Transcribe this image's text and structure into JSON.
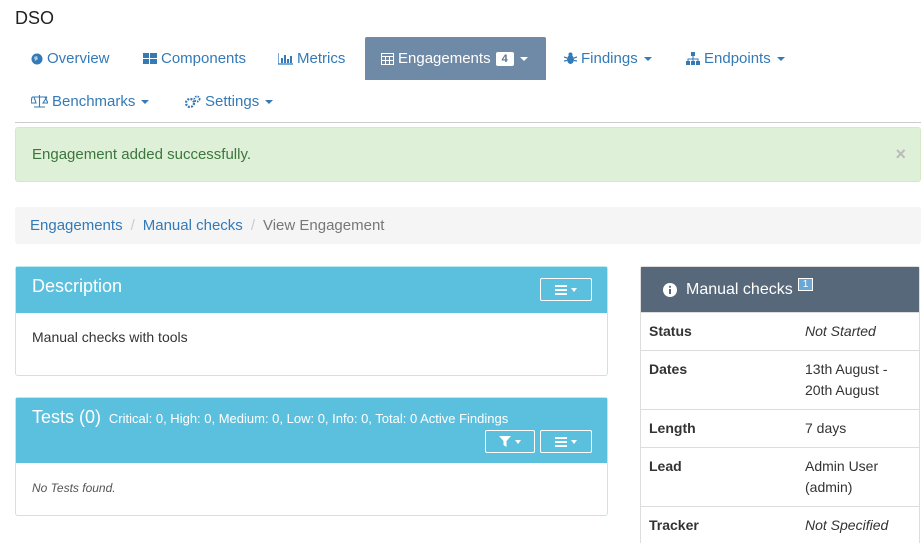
{
  "product": {
    "title": "DSO"
  },
  "nav": {
    "tabs": [
      {
        "label": "Overview",
        "icon": "globe-icon"
      },
      {
        "label": "Components",
        "icon": "table-icon"
      },
      {
        "label": "Metrics",
        "icon": "bar-chart-icon"
      },
      {
        "label": "Engagements",
        "icon": "calendar-icon",
        "badge": "4",
        "active": true
      },
      {
        "label": "Findings",
        "icon": "bug-icon"
      },
      {
        "label": "Endpoints",
        "icon": "sitemap-icon"
      },
      {
        "label": "Benchmarks",
        "icon": "balance-scale-icon"
      },
      {
        "label": "Settings",
        "icon": "cogs-icon"
      }
    ]
  },
  "alert": {
    "message": "Engagement added successfully.",
    "close": "×"
  },
  "breadcrumb": {
    "items": [
      "Engagements",
      "Manual checks",
      "View Engagement"
    ]
  },
  "description": {
    "title": "Description",
    "body": "Manual checks with tools"
  },
  "tests": {
    "title": "Tests (0)",
    "summary": "Critical: 0, High: 0, Medium: 0, Low: 0, Info: 0, Total: 0 Active Findings",
    "empty": "No Tests found."
  },
  "engagement_card": {
    "title": "Manual checks",
    "badge": "1",
    "rows": [
      {
        "key": "Status",
        "value": "Not Started"
      },
      {
        "key": "Dates",
        "value": "13th August - 20th August"
      },
      {
        "key": "Length",
        "value": "7 days"
      },
      {
        "key": "Lead",
        "value": "Admin User (admin)"
      },
      {
        "key": "Tracker",
        "value": "Not Specified"
      }
    ]
  },
  "colors": {
    "accent": "#5bc0de",
    "active_tab": "#6f8aa6",
    "side_header": "#56687a",
    "alert_bg": "#dff0d8"
  }
}
